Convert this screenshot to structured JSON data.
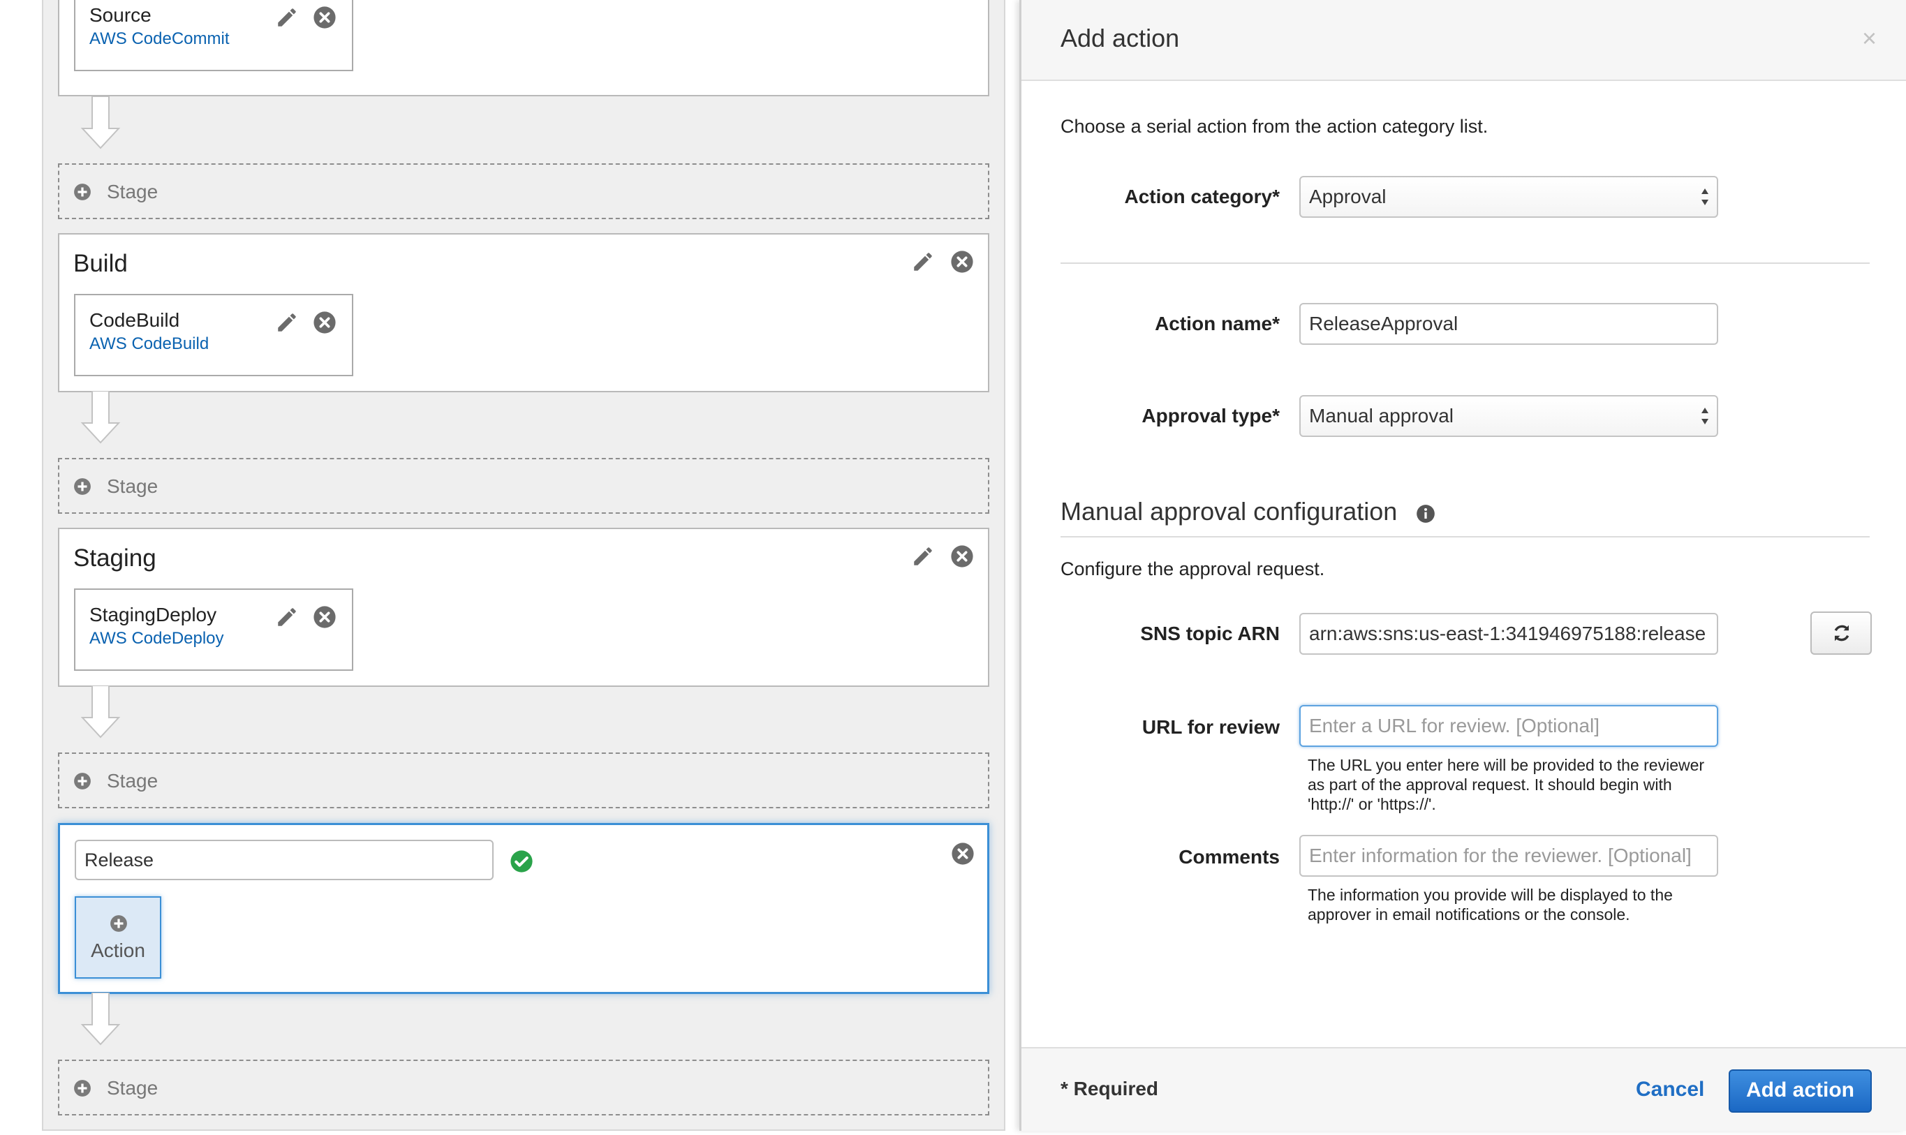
{
  "pipeline": {
    "stages": [
      {
        "title": "",
        "action": {
          "name": "Source",
          "provider": "AWS CodeCommit"
        }
      },
      {
        "title": "Build",
        "action": {
          "name": "CodeBuild",
          "provider": "AWS CodeBuild"
        }
      },
      {
        "title": "Staging",
        "action": {
          "name": "StagingDeploy",
          "provider": "AWS CodeDeploy"
        }
      }
    ],
    "add_stage_label": "Stage",
    "new_stage": {
      "name_value": "Release",
      "add_action_label": "Action"
    }
  },
  "dialog": {
    "title": "Add action",
    "close_glyph": "×",
    "intro": "Choose a serial action from the action category list.",
    "action_category": {
      "label": "Action category*",
      "value": "Approval"
    },
    "action_name": {
      "label": "Action name*",
      "value": "ReleaseApproval"
    },
    "approval_type": {
      "label": "Approval type*",
      "value": "Manual approval"
    },
    "section": {
      "title": "Manual approval configuration",
      "description": "Configure the approval request."
    },
    "sns_topic": {
      "label": "SNS topic ARN",
      "value": "arn:aws:sns:us-east-1:341946975188:release"
    },
    "url_for_review": {
      "label": "URL for review",
      "placeholder": "Enter a URL for review. [Optional]",
      "help": "The URL you enter here will be provided to the reviewer as part of the approval request. It should begin with 'http://' or 'https://'."
    },
    "comments": {
      "label": "Comments",
      "placeholder": "Enter information for the reviewer. [Optional]",
      "help": "The information you provide will be displayed to the approver in email notifications or the console."
    },
    "footer": {
      "required_note": "* Required",
      "cancel_label": "Cancel",
      "submit_label": "Add action"
    }
  },
  "colors": {
    "accent": "#1f6ec4",
    "active_border": "#3b8fd6",
    "success": "#2aa34a"
  },
  "icons": [
    "pencil-icon",
    "remove-icon",
    "plus-circle-icon",
    "check-circle-icon",
    "info-icon",
    "refresh-icon",
    "select-arrows-icon",
    "down-arrow-connector"
  ]
}
